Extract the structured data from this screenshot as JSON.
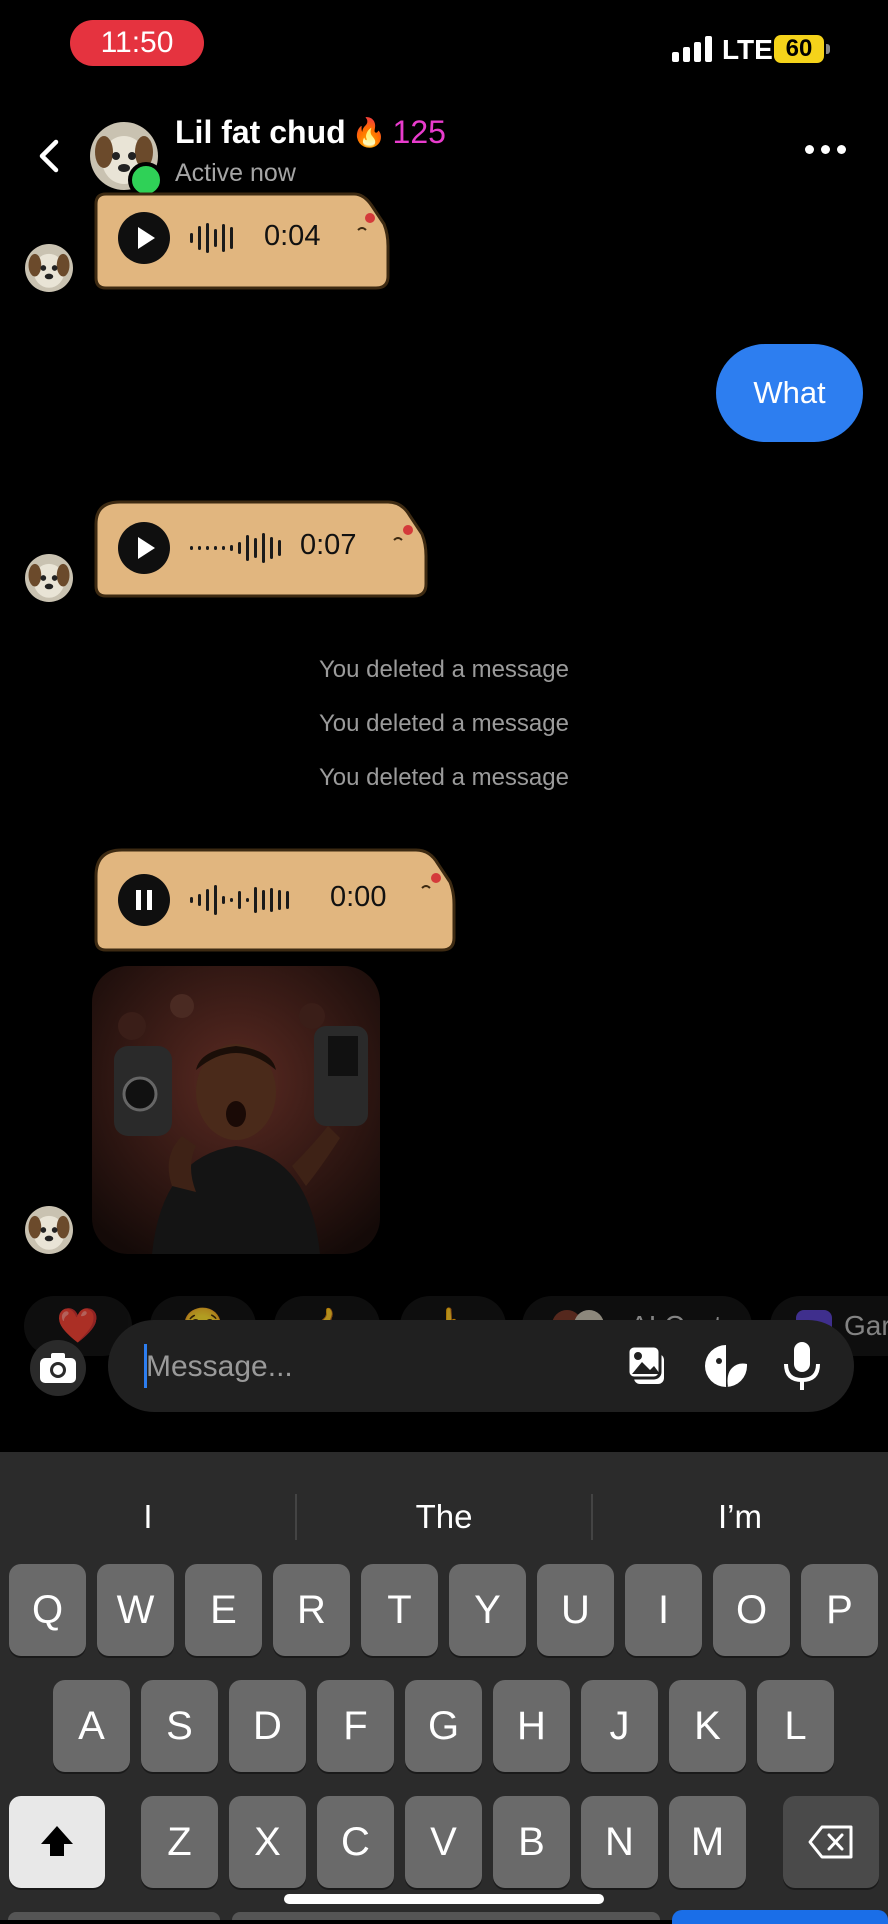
{
  "status_bar": {
    "time": "11:50",
    "network": "LTE",
    "battery": "60"
  },
  "header": {
    "name": "Lil fat chud",
    "streak_emoji": "🔥",
    "streak_count": "125",
    "status": "Active now"
  },
  "messages": {
    "voice1_duration": "0:04",
    "outgoing_text": "What",
    "voice2_duration": "0:07",
    "system": [
      "You deleted a message",
      "You deleted a message",
      "You deleted a message"
    ],
    "voice3_duration": "0:00"
  },
  "reactions": [
    {
      "emoji": "❤️"
    },
    {
      "emoji": "😂"
    },
    {
      "emoji": "👍"
    },
    {
      "emoji": "👆"
    },
    {
      "label": "AI Cast"
    },
    {
      "label": "Gar"
    }
  ],
  "composer": {
    "placeholder": "Message..."
  },
  "keyboard": {
    "suggestions": [
      "I",
      "The",
      "I’m"
    ],
    "row1": [
      "Q",
      "W",
      "E",
      "R",
      "T",
      "Y",
      "U",
      "I",
      "O",
      "P"
    ],
    "row2": [
      "A",
      "S",
      "D",
      "F",
      "G",
      "H",
      "J",
      "K",
      "L"
    ],
    "row3": [
      "Z",
      "X",
      "C",
      "V",
      "B",
      "N",
      "M"
    ]
  },
  "colors": {
    "accent_blue": "#2d7ef0",
    "bubble_tan": "#e1b67f",
    "streak_pink": "#e93ccd",
    "online_green": "#2fd157"
  }
}
